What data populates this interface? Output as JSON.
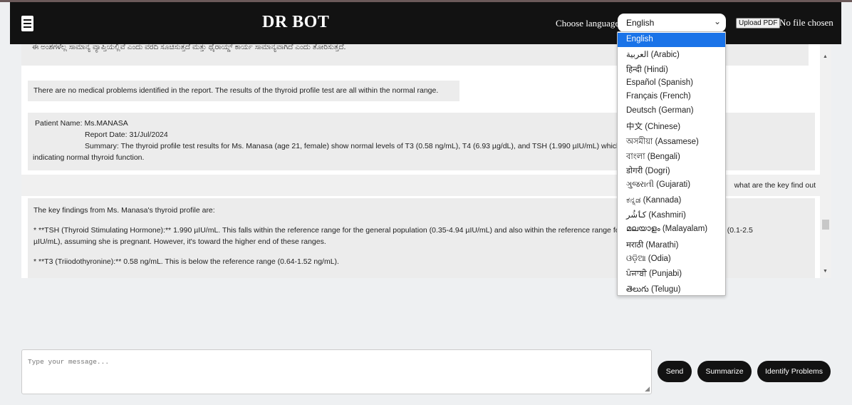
{
  "header": {
    "title": "DR BOT",
    "language_label": "Choose language:",
    "selected_language": "English",
    "upload_button": "Upload PDF",
    "file_status": "No file chosen"
  },
  "languages": [
    "English",
    "العربية (Arabic)",
    "हिन्दी (Hindi)",
    "Español (Spanish)",
    "Français (French)",
    "Deutsch (German)",
    "中文 (Chinese)",
    "অসমীয়া (Assamese)",
    "বাংলা (Bengali)",
    "डोगरी (Dogri)",
    "ગુજરાતી (Gujarati)",
    "ಕನ್ನಡ (Kannada)",
    "کٲشُر (Kashmiri)",
    "മലയാളം (Malayalam)",
    "मराठी (Marathi)",
    "ଓଡ଼ିଆ (Odia)",
    "ਪੰਜਾਬੀ (Punjabi)",
    "తెలుగు (Telugu)"
  ],
  "chat": {
    "msg_top_partial": "ಈ ಅಂಶಗಳೆಲ್ಲ ಸಾಮಾನ್ಯ ವ್ಯಾಪ್ತಿಯಲ್ಲಿವೆ ಎಂದು ವರದಿ ಸೂಚಿಸುತ್ತದೆ ಮತ್ತು ಥೈರಾಯ್ಡ್ ಕಾರ್ಯ ಸಾಮಾನ್ಯವಾಗಿದೆ ಎಂದು ತೋರಿಸುತ್ತದೆ.",
    "msg_no_problems": "There are no medical problems identified in the report. The results of the thyroid profile test are all within the normal range.",
    "msg_summary_line1": "Patient Name: Ms.MANASA",
    "msg_summary_line2": "Report Date: 31/Jul/2024",
    "msg_summary_line3": "Summary: The thyroid profile test results for Ms. Manasa (age 21, female) show normal levels of T3 (0.58 ng/mL), T4 (6.93 µg/dL), and TSH (1.990 µIU/mL) which fall within the reference ranges",
    "msg_summary_line4": "indicating normal thyroid function.",
    "msg_user_question": "what are the key find out",
    "msg_findings_intro": "The key findings from Ms. Manasa's thyroid profile are:",
    "msg_findings_tsh1": "* **TSH (Thyroid Stimulating Hormone):** 1.990 µIU/mL.  This falls within the reference range for the general population (0.35-4.94 µIU/mL) and also within the reference range for the first trimester of pregnancy (0.1-2.5",
    "msg_findings_tsh2": "µIU/mL), assuming she is pregnant.  However, it's toward the higher end of these ranges.",
    "msg_findings_t3": "* **T3 (Triiodothyronine):** 0.58 ng/mL.  This is below the reference range (0.64-1.52 ng/mL)."
  },
  "composer": {
    "placeholder": "Type your message...",
    "send": "Send",
    "summarize": "Summarize",
    "identify": "Identify Problems"
  }
}
